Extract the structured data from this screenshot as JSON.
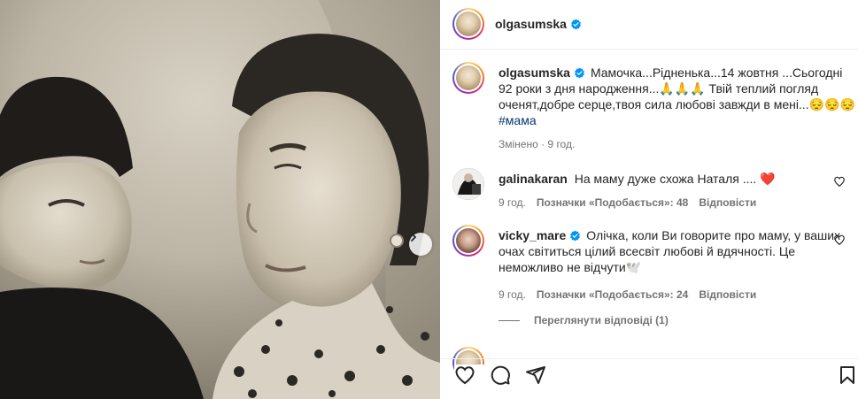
{
  "post": {
    "username": "olgasumska",
    "caption": "Мамочка...Рідненька...14 жовтня ...Сьогодні 92 роки з дня народження...🙏🙏🙏 Твій теплий погляд оченят,добре серце,твоя сила любові завжди в мені...😔😔😔",
    "hashtag": "#мама",
    "edited_time": "Змінено · 9 год."
  },
  "comments": [
    {
      "username": "galinakaran",
      "text": "На маму дуже схожа Наталя .... ❤️",
      "time": "9 год.",
      "likes": "Позначки «Подобається»: 48",
      "reply": "Відповісти"
    },
    {
      "username": "vicky_mare",
      "text": "Олічка, коли Ви говорите про маму, у ваших очах світиться цілий всесвіт любові й вдячності. Це неможливо не відчути🕊️",
      "time": "9 год.",
      "likes": "Позначки «Подобається»: 24",
      "reply": "Відповісти",
      "view_replies": "Переглянути відповіді (1)"
    }
  ],
  "icons": {
    "like": "heart-icon",
    "comment": "comment-icon",
    "share": "share-icon",
    "save": "bookmark-icon",
    "next": "chevron-right-icon",
    "verified": "verified-badge-icon"
  },
  "colors": {
    "verified": "#0095f6",
    "heart_red": "#ed4956",
    "hashtag": "#00376b",
    "secondary_text": "#737373"
  }
}
